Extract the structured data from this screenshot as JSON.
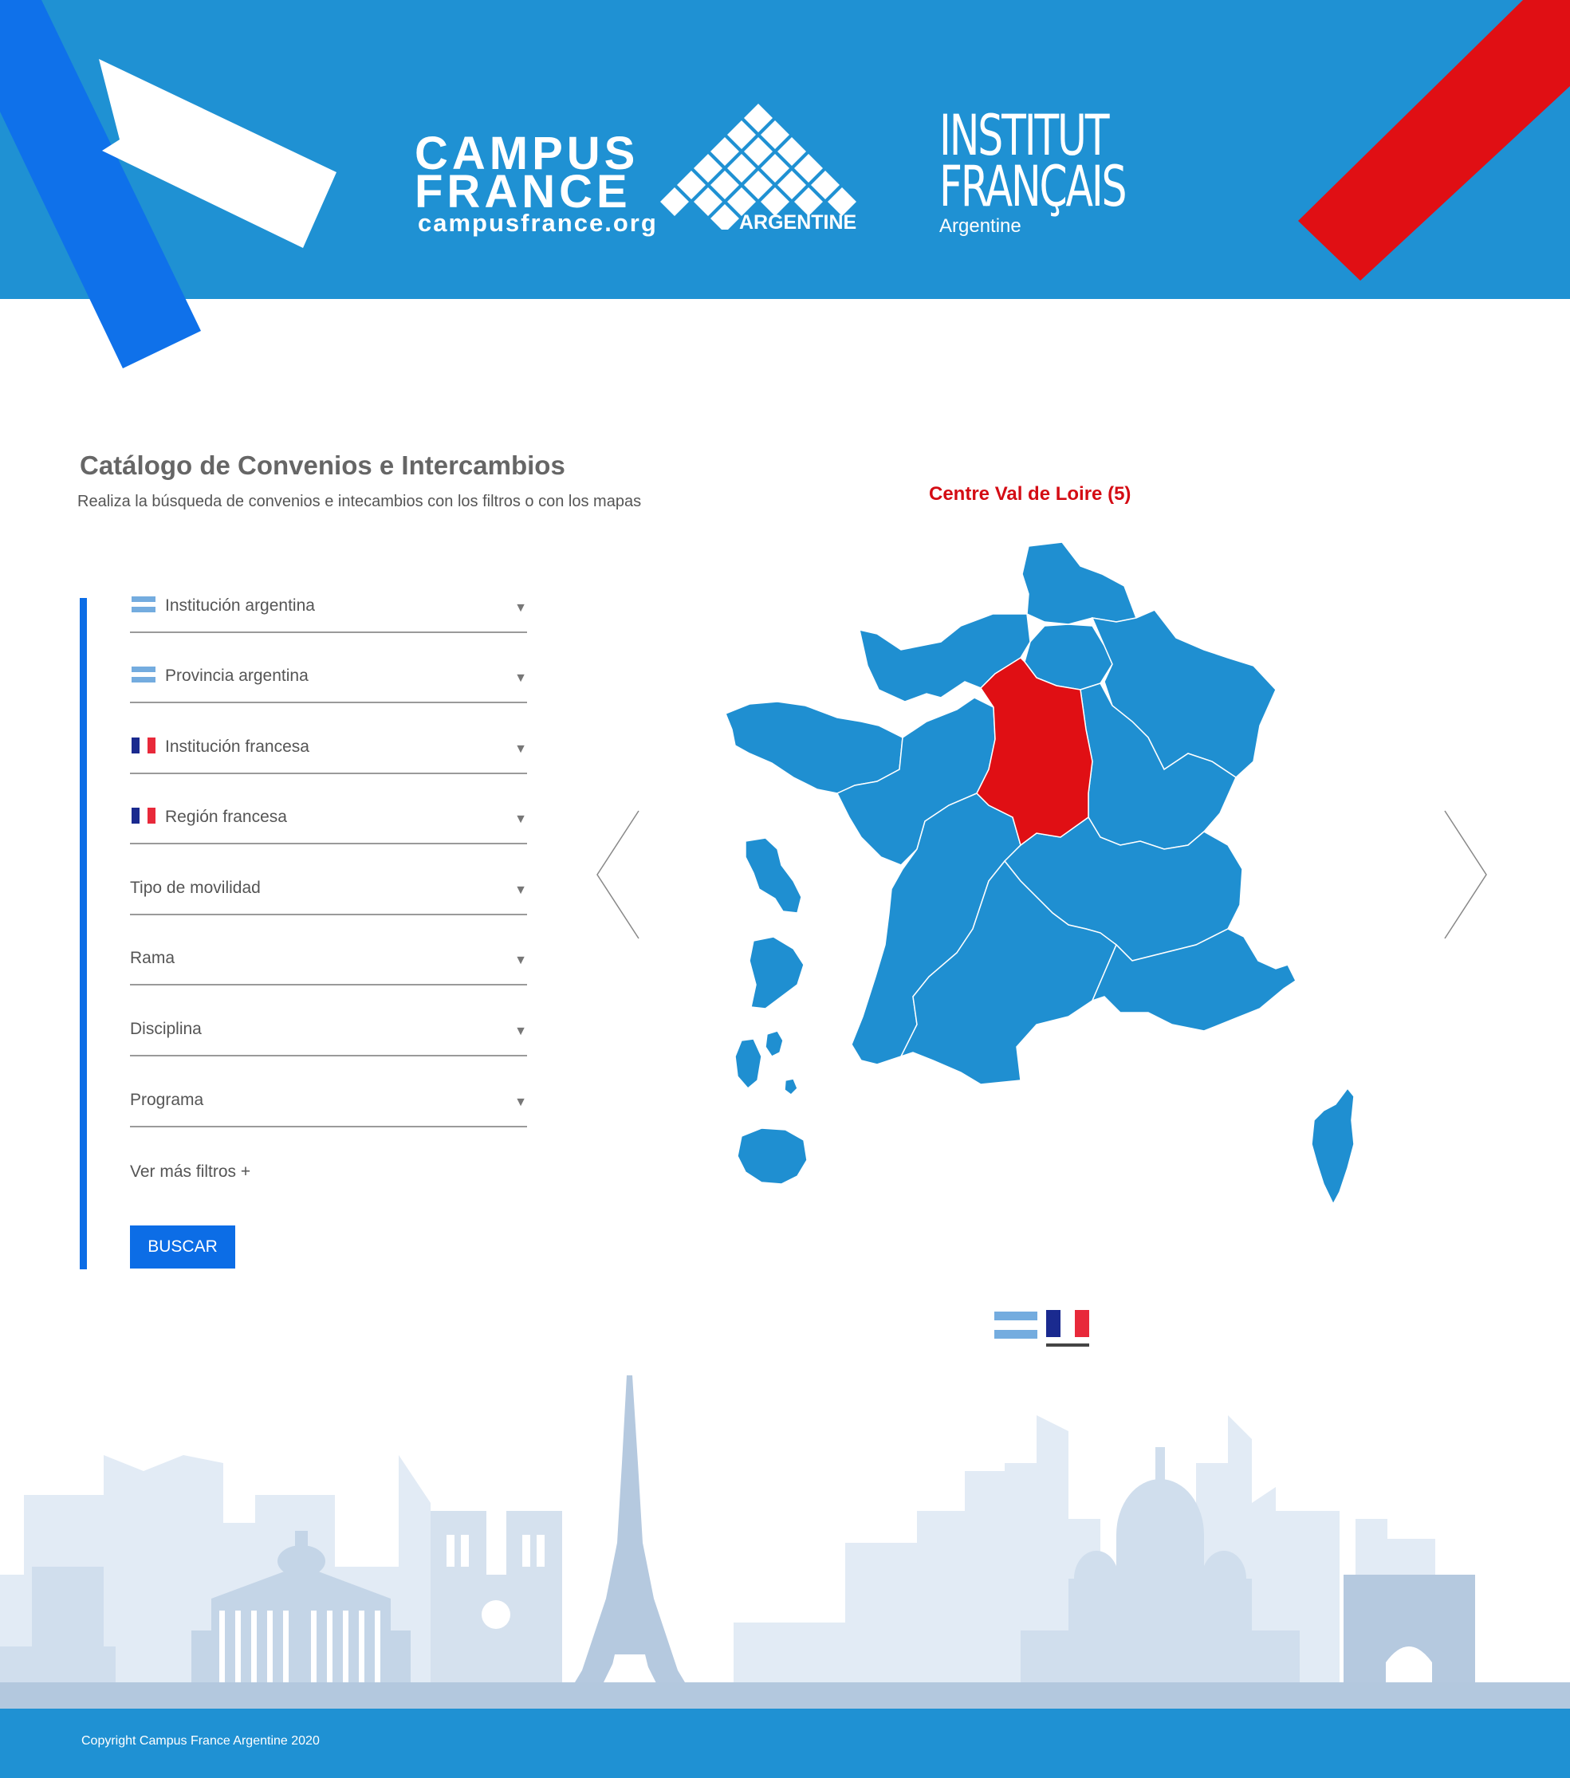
{
  "header": {
    "campus_line1": "CAMPUS",
    "campus_line2": "FRANCE",
    "campus_url": "campusfrance.org",
    "campus_country": "ARGENTINE",
    "institut_line1": "INSTITUT",
    "institut_line2": "FRANÇAIS",
    "institut_country": "Argentine"
  },
  "catalog": {
    "title": "Catálogo de Convenios e Intercambios",
    "subtitle": "Realiza la búsqueda de convenios e intecambios con los filtros o con los mapas"
  },
  "filters": [
    {
      "label": "Institución argentina",
      "flag": "argentina-flag"
    },
    {
      "label": "Provincia argentina",
      "flag": "argentina-flag"
    },
    {
      "label": "Institución francesa",
      "flag": "france-flag"
    },
    {
      "label": "Región francesa",
      "flag": "france-flag"
    },
    {
      "label": "Tipo de movilidad",
      "flag": ""
    },
    {
      "label": "Rama",
      "flag": ""
    },
    {
      "label": "Disciplina",
      "flag": ""
    },
    {
      "label": "Programa",
      "flag": ""
    }
  ],
  "more_filters": "Ver más filtros +",
  "search_button": "BUSCAR",
  "map": {
    "selected_region": "Centre Val de Loire (5)",
    "active_country": "france",
    "colors": {
      "region": "#1f8fd1",
      "selected": "#e00f14"
    }
  },
  "footer": {
    "copyright": "Copyright Campus France Argentine 2020"
  },
  "colors": {
    "header_blue": "#1f91d3",
    "accent_blue": "#0c6de6",
    "accent_red": "#e00f14"
  }
}
